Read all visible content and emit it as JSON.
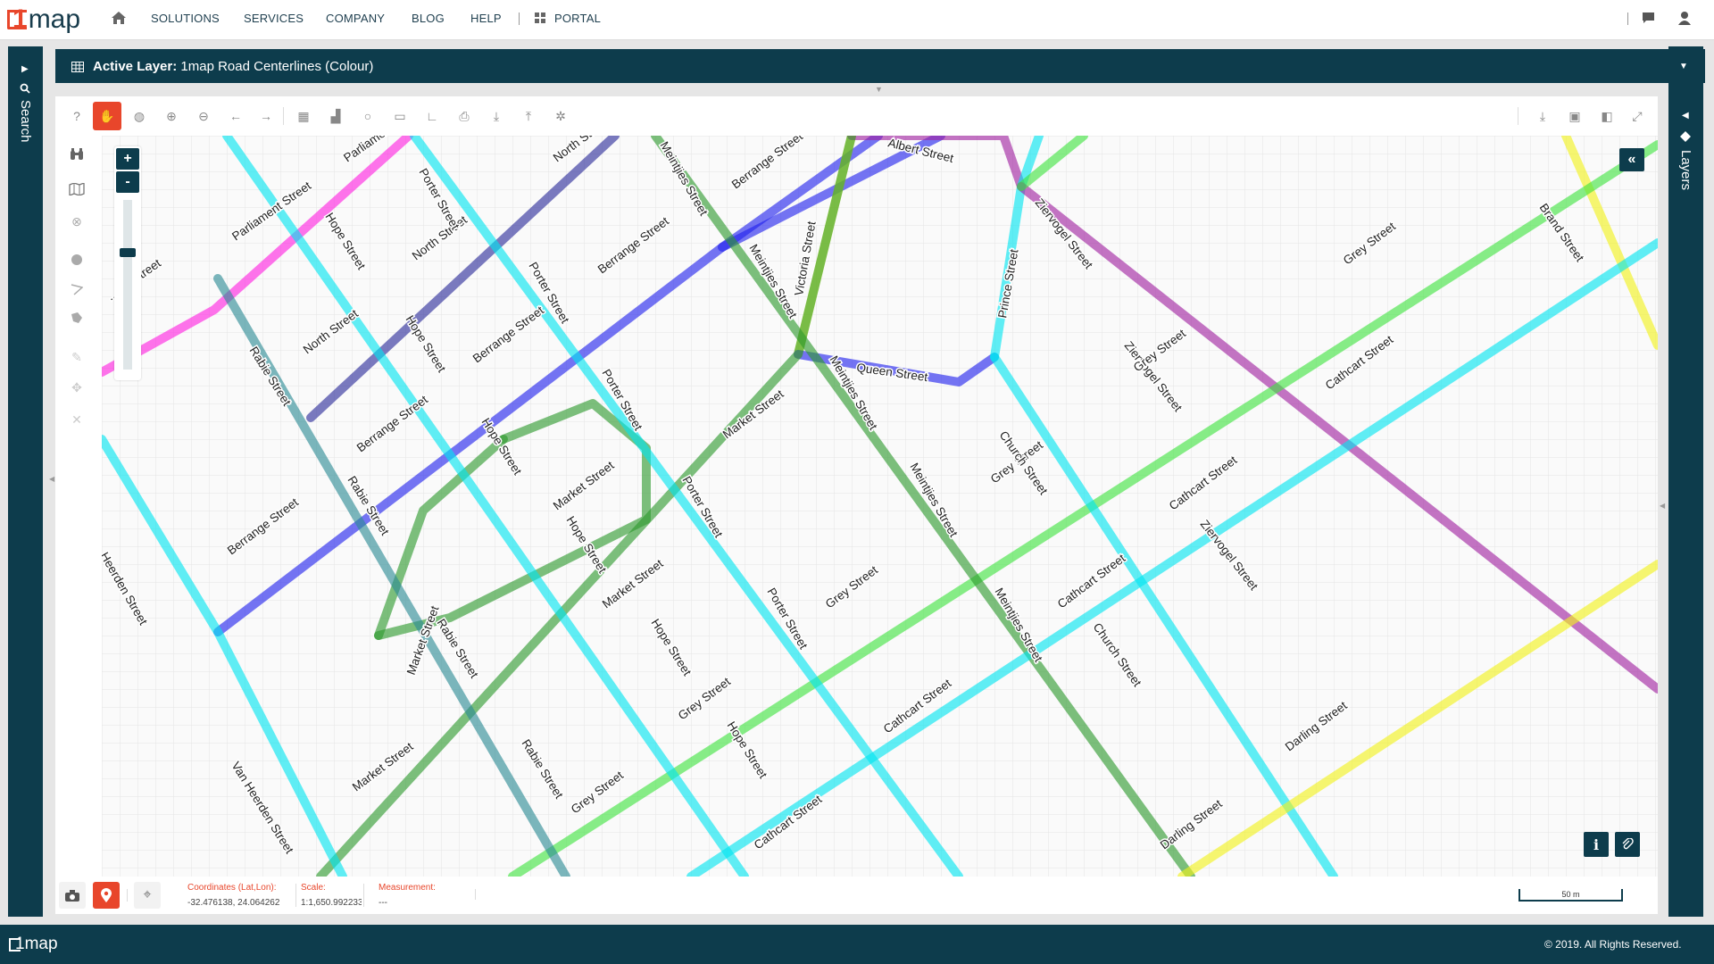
{
  "brand": {
    "logo_text": "map",
    "logo_num": "1"
  },
  "nav": {
    "items": [
      "SOLUTIONS",
      "SERVICES",
      "COMPANY",
      "BLOG",
      "HELP"
    ],
    "portal": "PORTAL"
  },
  "left_panel": {
    "label": "Search"
  },
  "right_panel": {
    "label": "Layers"
  },
  "active_layer": {
    "prefix": "Active Layer:",
    "name": "1map Road Centerlines (Colour)"
  },
  "toolbar": {
    "tools": [
      "help-icon",
      "pan-icon",
      "globe-icon",
      "zoom-in-icon",
      "zoom-out-icon",
      "back-icon",
      "forward-icon",
      "table-icon",
      "chart-icon",
      "circle-icon",
      "ruler-icon",
      "angle-icon",
      "print-icon",
      "download-icon",
      "upload-icon",
      "settings-icon"
    ],
    "right_tools": [
      "download-icon",
      "image-export-icon",
      "split-view-icon",
      "fullscreen-icon"
    ]
  },
  "map": {
    "zoom_in": "+",
    "zoom_out": "-",
    "collapse": "«",
    "info": "i",
    "attach": "⊘",
    "colors": {
      "cyan": "#00e5f0",
      "magenta": "#ff1fe0",
      "dark_blue": "#2a2a9a",
      "blue": "#2020ee",
      "teal": "#2c8a94",
      "green": "#2d9a2d",
      "lime": "#3fe33f",
      "yellow": "#f2f21a",
      "purple": "#a020a0"
    },
    "labels": {
      "parliament1": "Parliament Street",
      "parliament2": "Parliament Street",
      "parliament3": "...ent Street",
      "north1": "North Street",
      "north2": "North Street",
      "north3": "North Street",
      "porter1": "Porter Street",
      "porter2": "Porter Street",
      "porter3": "Porter Street",
      "porter4": "Porter Street",
      "porter5": "Porter Street",
      "hope1": "Hope Street",
      "hope2": "Hope Street",
      "hope3": "Hope Street",
      "hope4": "Hope Street",
      "hope5": "Hope Street",
      "hope6": "Hope Street",
      "meintjies1": "Meintjies Street",
      "meintjies2": "Meintjies Street",
      "meintjies3": "Meintjies Street",
      "meintjies4": "Meintjies Street",
      "meintjies5": "Meintjies Street",
      "berrange1": "Berrange Street",
      "berrange2": "Berrange Street",
      "berrange3": "Berrange Street",
      "berrange4": "Berrange Street",
      "berrange5": "Berrange Street",
      "victoria": "Victoria Street",
      "albert": "Albert Street",
      "ziervogel1": "Ziervogel Street",
      "ziervogel2": "Ziervogel Street",
      "ziervogel3": "Ziervogel Street",
      "brand": "Brand Street",
      "prince": "Prince Street",
      "queen": "Queen Street",
      "rabie1": "Rabie Street",
      "rabie2": "Rabie Street",
      "rabie3": "Rabie Street",
      "rabie4": "Rabie Street",
      "market1": "Market Street",
      "market2": "Market Street",
      "market3": "Market Street",
      "market4": "Market Street",
      "market5": "Market Street",
      "grey1": "Grey Street",
      "grey2": "Grey Street",
      "grey3": "Grey Street",
      "grey4": "Grey Street",
      "grey5": "Grey Street",
      "grey6": "Grey Street",
      "church1": "Church Street",
      "church2": "Church Street",
      "cathcart1": "Cathcart Street",
      "cathcart2": "Cathcart Street",
      "cathcart3": "Cathcart Street",
      "cathcart4": "Cathcart Street",
      "cathcart5": "Cathcart Street",
      "darling1": "Darling Street",
      "darling2": "Darling Street",
      "vanheerden1": "Heerden Street",
      "vanheerden2": "Van Heerden Street"
    }
  },
  "status": {
    "coords_label": "Coordinates (Lat,Lon):",
    "coords_value": "-32.476138, 24.064262",
    "scale_label": "Scale:",
    "scale_value": "1:1,650.992233",
    "measure_label": "Measurement:",
    "measure_value": "---",
    "scalebar": "50 m"
  },
  "footer": {
    "copyright": "© 2019. All Rights Reserved."
  }
}
